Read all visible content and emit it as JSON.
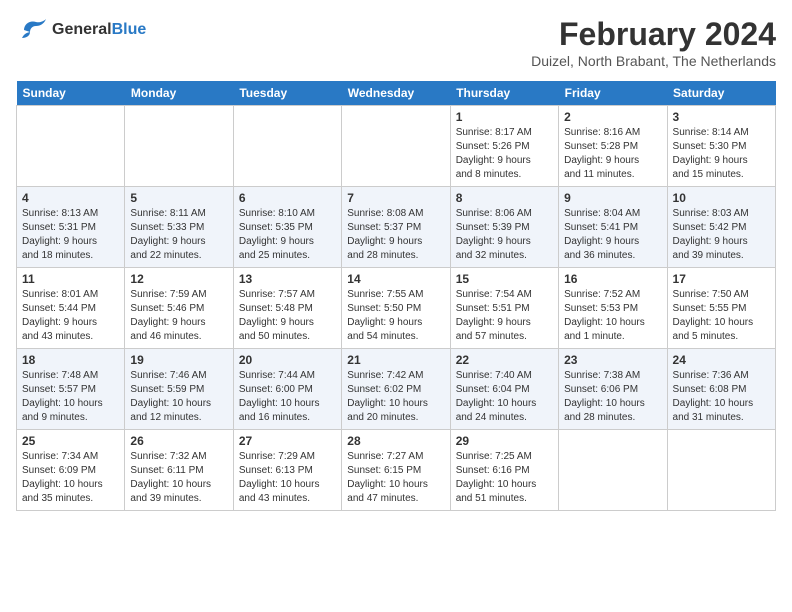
{
  "header": {
    "logo_line1": "General",
    "logo_line2": "Blue",
    "month_year": "February 2024",
    "location": "Duizel, North Brabant, The Netherlands"
  },
  "days_of_week": [
    "Sunday",
    "Monday",
    "Tuesday",
    "Wednesday",
    "Thursday",
    "Friday",
    "Saturday"
  ],
  "weeks": [
    [
      {
        "day": "",
        "content": ""
      },
      {
        "day": "",
        "content": ""
      },
      {
        "day": "",
        "content": ""
      },
      {
        "day": "",
        "content": ""
      },
      {
        "day": "1",
        "content": "Sunrise: 8:17 AM\nSunset: 5:26 PM\nDaylight: 9 hours\nand 8 minutes."
      },
      {
        "day": "2",
        "content": "Sunrise: 8:16 AM\nSunset: 5:28 PM\nDaylight: 9 hours\nand 11 minutes."
      },
      {
        "day": "3",
        "content": "Sunrise: 8:14 AM\nSunset: 5:30 PM\nDaylight: 9 hours\nand 15 minutes."
      }
    ],
    [
      {
        "day": "4",
        "content": "Sunrise: 8:13 AM\nSunset: 5:31 PM\nDaylight: 9 hours\nand 18 minutes."
      },
      {
        "day": "5",
        "content": "Sunrise: 8:11 AM\nSunset: 5:33 PM\nDaylight: 9 hours\nand 22 minutes."
      },
      {
        "day": "6",
        "content": "Sunrise: 8:10 AM\nSunset: 5:35 PM\nDaylight: 9 hours\nand 25 minutes."
      },
      {
        "day": "7",
        "content": "Sunrise: 8:08 AM\nSunset: 5:37 PM\nDaylight: 9 hours\nand 28 minutes."
      },
      {
        "day": "8",
        "content": "Sunrise: 8:06 AM\nSunset: 5:39 PM\nDaylight: 9 hours\nand 32 minutes."
      },
      {
        "day": "9",
        "content": "Sunrise: 8:04 AM\nSunset: 5:41 PM\nDaylight: 9 hours\nand 36 minutes."
      },
      {
        "day": "10",
        "content": "Sunrise: 8:03 AM\nSunset: 5:42 PM\nDaylight: 9 hours\nand 39 minutes."
      }
    ],
    [
      {
        "day": "11",
        "content": "Sunrise: 8:01 AM\nSunset: 5:44 PM\nDaylight: 9 hours\nand 43 minutes."
      },
      {
        "day": "12",
        "content": "Sunrise: 7:59 AM\nSunset: 5:46 PM\nDaylight: 9 hours\nand 46 minutes."
      },
      {
        "day": "13",
        "content": "Sunrise: 7:57 AM\nSunset: 5:48 PM\nDaylight: 9 hours\nand 50 minutes."
      },
      {
        "day": "14",
        "content": "Sunrise: 7:55 AM\nSunset: 5:50 PM\nDaylight: 9 hours\nand 54 minutes."
      },
      {
        "day": "15",
        "content": "Sunrise: 7:54 AM\nSunset: 5:51 PM\nDaylight: 9 hours\nand 57 minutes."
      },
      {
        "day": "16",
        "content": "Sunrise: 7:52 AM\nSunset: 5:53 PM\nDaylight: 10 hours\nand 1 minute."
      },
      {
        "day": "17",
        "content": "Sunrise: 7:50 AM\nSunset: 5:55 PM\nDaylight: 10 hours\nand 5 minutes."
      }
    ],
    [
      {
        "day": "18",
        "content": "Sunrise: 7:48 AM\nSunset: 5:57 PM\nDaylight: 10 hours\nand 9 minutes."
      },
      {
        "day": "19",
        "content": "Sunrise: 7:46 AM\nSunset: 5:59 PM\nDaylight: 10 hours\nand 12 minutes."
      },
      {
        "day": "20",
        "content": "Sunrise: 7:44 AM\nSunset: 6:00 PM\nDaylight: 10 hours\nand 16 minutes."
      },
      {
        "day": "21",
        "content": "Sunrise: 7:42 AM\nSunset: 6:02 PM\nDaylight: 10 hours\nand 20 minutes."
      },
      {
        "day": "22",
        "content": "Sunrise: 7:40 AM\nSunset: 6:04 PM\nDaylight: 10 hours\nand 24 minutes."
      },
      {
        "day": "23",
        "content": "Sunrise: 7:38 AM\nSunset: 6:06 PM\nDaylight: 10 hours\nand 28 minutes."
      },
      {
        "day": "24",
        "content": "Sunrise: 7:36 AM\nSunset: 6:08 PM\nDaylight: 10 hours\nand 31 minutes."
      }
    ],
    [
      {
        "day": "25",
        "content": "Sunrise: 7:34 AM\nSunset: 6:09 PM\nDaylight: 10 hours\nand 35 minutes."
      },
      {
        "day": "26",
        "content": "Sunrise: 7:32 AM\nSunset: 6:11 PM\nDaylight: 10 hours\nand 39 minutes."
      },
      {
        "day": "27",
        "content": "Sunrise: 7:29 AM\nSunset: 6:13 PM\nDaylight: 10 hours\nand 43 minutes."
      },
      {
        "day": "28",
        "content": "Sunrise: 7:27 AM\nSunset: 6:15 PM\nDaylight: 10 hours\nand 47 minutes."
      },
      {
        "day": "29",
        "content": "Sunrise: 7:25 AM\nSunset: 6:16 PM\nDaylight: 10 hours\nand 51 minutes."
      },
      {
        "day": "",
        "content": ""
      },
      {
        "day": "",
        "content": ""
      }
    ]
  ]
}
